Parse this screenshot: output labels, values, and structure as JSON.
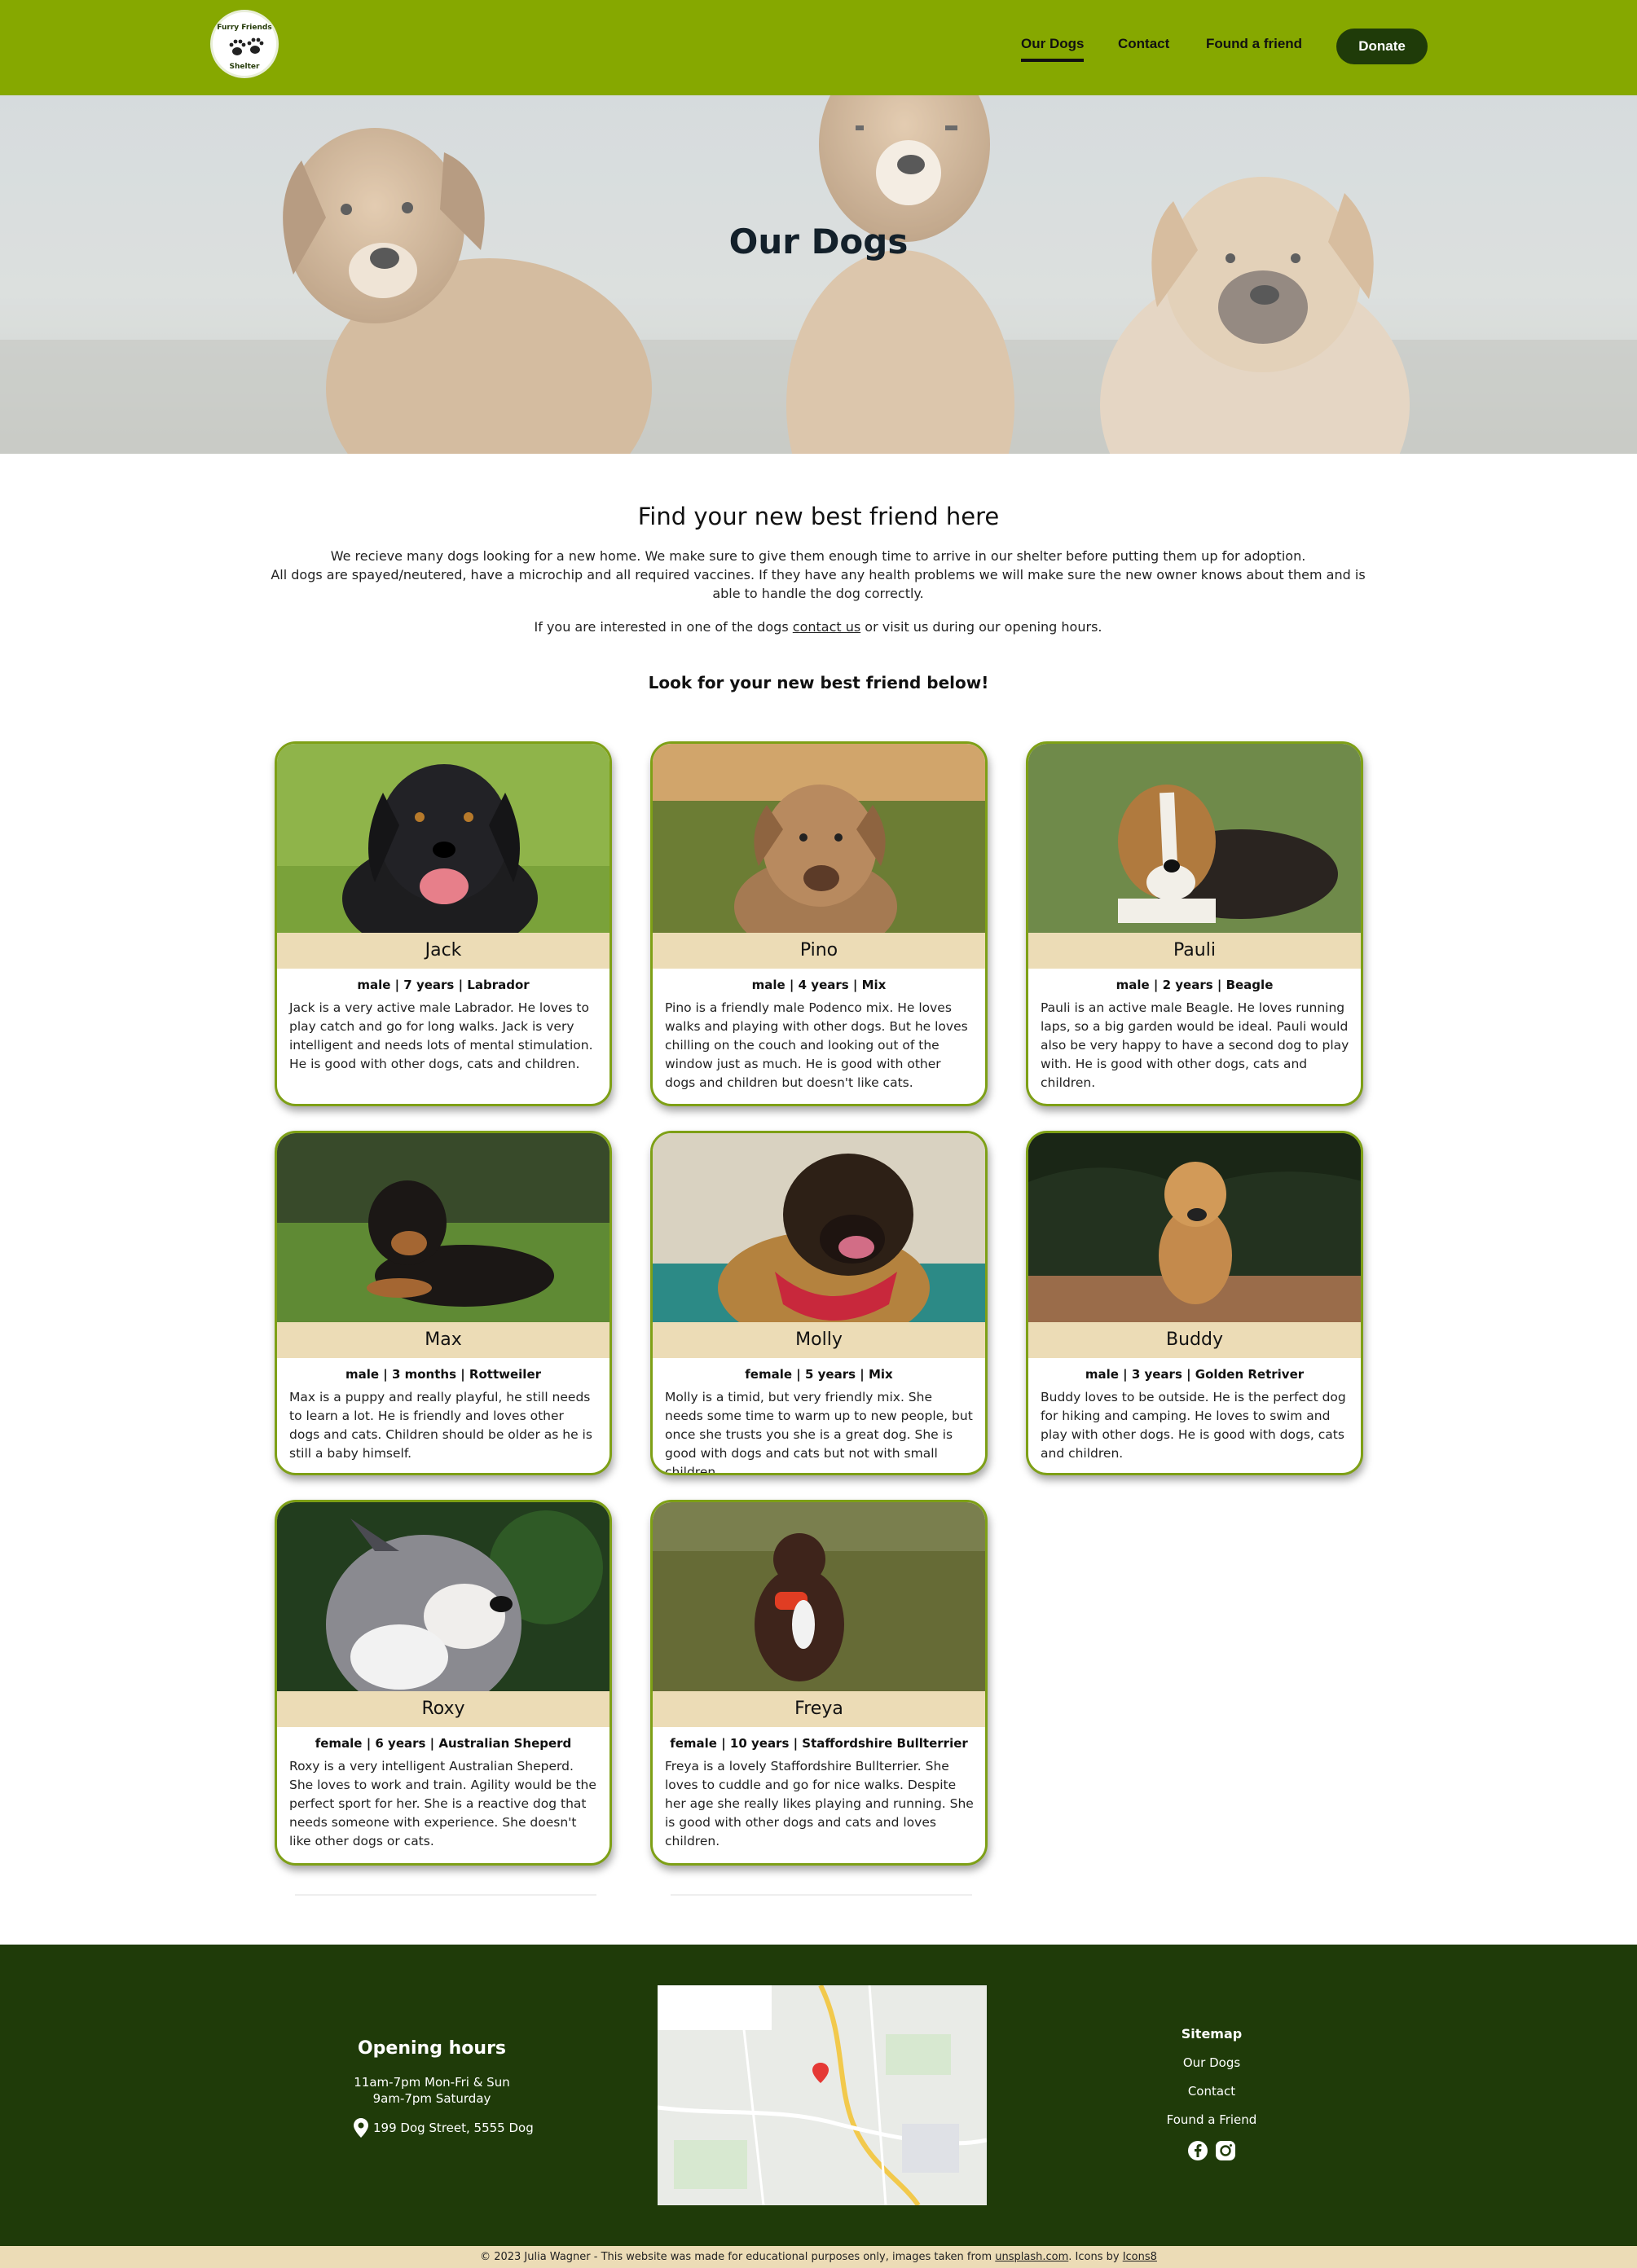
{
  "nav": {
    "logo_top": "Furry Friends",
    "logo_bottom": "Shelter",
    "links": [
      "Our Dogs",
      "Contact",
      "Found a friend"
    ],
    "donate": "Donate"
  },
  "hero": {
    "title": "Our Dogs"
  },
  "intro": {
    "title": "Find your new best friend here",
    "p1": "We recieve many dogs looking for a new home. We make sure to give them enough time to arrive in our shelter before putting them up for adoption.",
    "p2": "All dogs are spayed/neutered, have a microchip and all required vaccines. If they have any health problems we will make sure the new owner knows about them and is able to handle the dog correctly.",
    "p3_before": "If you are interested in one of the dogs ",
    "p3_link": "contact us",
    "p3_after": " or visit us during our opening hours.",
    "look": "Look for your new best friend below!"
  },
  "dogs": [
    {
      "name": "Jack",
      "meta": "male | 7 years | Labrador",
      "desc": "Jack is a very active male Labrador. He loves to play catch and go for long walks. Jack is very intelligent and needs lots of mental stimulation. He is good with other dogs, cats and children."
    },
    {
      "name": "Pino",
      "meta": "male | 4 years | Mix",
      "desc": "Pino is a friendly male Podenco mix. He loves walks and playing with other dogs. But he loves chilling on the couch and looking out of the window just as much. He is good with other dogs and children but doesn't like cats."
    },
    {
      "name": "Pauli",
      "meta": "male | 2 years | Beagle",
      "desc": "Pauli is an active male Beagle. He loves running laps, so a big garden would be ideal. Pauli would also be very happy to have a second dog to play with. He is good with other dogs, cats and children."
    },
    {
      "name": "Max",
      "meta": "male | 3 months | Rottweiler",
      "desc": "Max is a puppy and really playful, he still needs to learn a lot. He is friendly and loves other dogs and cats. Children should be older as he is still a baby himself."
    },
    {
      "name": "Molly",
      "meta": "female | 5 years | Mix",
      "desc": "Molly is a timid, but very friendly mix. She needs some time to warm up to new people, but once she trusts you she is a great dog. She is good with dogs and cats but not with small children."
    },
    {
      "name": "Buddy",
      "meta": "male | 3 years | Golden Retriver",
      "desc": "Buddy loves to be outside. He is the perfect dog for hiking and camping. He loves to swim and play with other dogs. He is good with dogs, cats and children."
    },
    {
      "name": "Roxy",
      "meta": "female | 6 years | Australian Sheperd",
      "desc": "Roxy is a very intelligent Australian Sheperd. She loves to work and train. Agility would be the perfect sport for her. She is a reactive dog that needs someone with experience. She doesn't like other dogs or cats."
    },
    {
      "name": "Freya",
      "meta": "female | 10 years | Staffordshire Bullterrier",
      "desc": "Freya is a lovely Staffordshire Bullterrier. She loves to cuddle and go for nice walks. Despite her age she really likes playing and running. She is good with other dogs and cats and loves children."
    }
  ],
  "footer": {
    "hours_title": "Opening hours",
    "hours_1": "11am-7pm Mon-Fri & Sun",
    "hours_2": "9am-7pm Saturday",
    "address": "199 Dog Street, 5555 Dog",
    "sitemap_title": "Sitemap",
    "sitemap_links": [
      "Our Dogs",
      "Contact",
      "Found a Friend"
    ]
  },
  "bottom": {
    "text_before": "© 2023 Julia Wagner - This website was made for educational purposes only, images taken from ",
    "link1": "unsplash.com",
    "text_mid": ". Icons by ",
    "link2": "Icons8"
  },
  "colors": {
    "nav": "#86a800",
    "footer": "#1f3b09",
    "card_border": "#7ea016",
    "name_band": "#ecdcb6"
  }
}
